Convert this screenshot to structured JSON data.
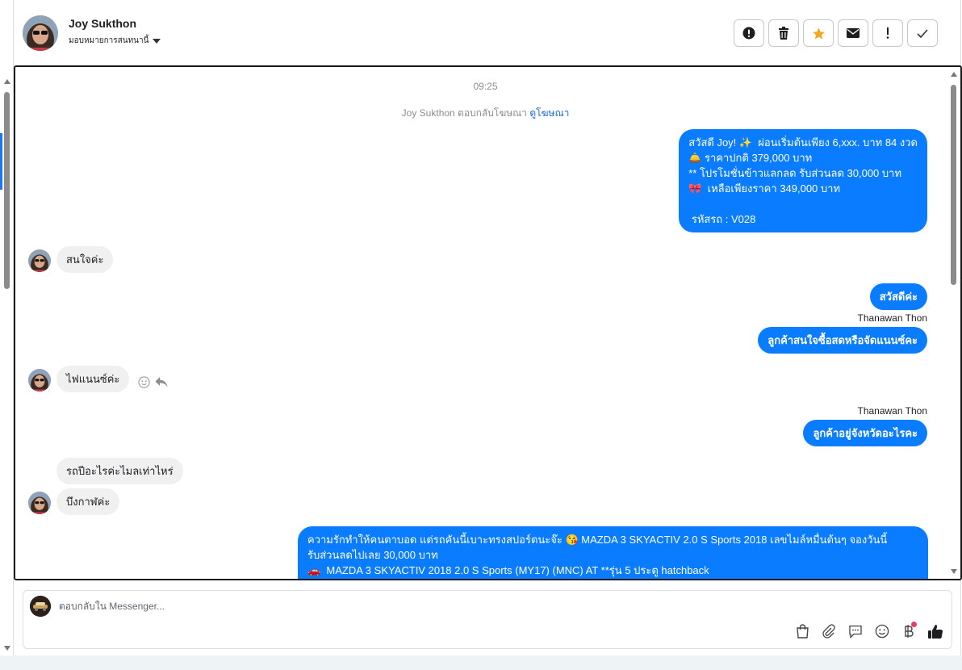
{
  "header": {
    "contact_name": "Joy Sukthon",
    "assign_label": "มอบหมายการสนทนานี้",
    "toolbar": {
      "icons": [
        "exclamation-circle-icon",
        "trash-icon",
        "star-icon",
        "envelope-icon",
        "exclamation-icon",
        "check-icon"
      ],
      "star_color": "#f5a623"
    }
  },
  "chat": {
    "timestamp": "09:25",
    "reply_note_prefix": "Joy Sukthon ตอบกลับโฆษณา",
    "reply_note_link": "ดูโฆษณา",
    "messages": [
      {
        "side": "out",
        "text": "สวัสดี Joy! ✨  ผ่อนเริ่มต้นเพียง 6,xxx. บาท 84 งวด\n🛎️ ราคาปกติ 379,000 บาท\n** โปรโมชั่นข้าวแลกลด รับส่วนลด 30,000 บาท\n🎀  เหลือเพียงราคา 349,000 บาท\n\n รหัสรถ : V028"
      },
      {
        "side": "in",
        "text": "สนใจค่ะ"
      },
      {
        "side": "out",
        "text": "สวัสดีค่ะ"
      },
      {
        "side": "out",
        "sender": "Thanawan Thon",
        "text": "ลูกค้าสนใจซื้อสดหรือจัดแนนซ์คะ"
      },
      {
        "side": "in",
        "text": "ไฟแนนซ์ค่ะ"
      },
      {
        "side": "out",
        "sender": "Thanawan Thon",
        "text": "ลูกค้าอยู่จังหวัดอะไรคะ"
      },
      {
        "side": "in",
        "text": "รถปีอะไรค่ะไมลเท่าไหร่"
      },
      {
        "side": "in",
        "text": "บึงกาฬค่ะ"
      },
      {
        "side": "out",
        "text": "ความรักทำให้คนตาบอด แต่รถคันนี้เบาะทรงสปอร์ตนะจ๊ะ 😘 MAZDA 3 SKYACTIV 2.0 S Sports 2018 เลขไมล์หมื่นต้นๆ จองวันนี้\nรับส่วนลดไปเลย 30,000 บาท\n🚗  MAZDA 3 SKYACTIV 2018 2.0 S Sports (MY17) (MNC) AT **รุ่น 5 ประตู hatchback"
      }
    ]
  },
  "composer": {
    "placeholder": "ตอบกลับใน Messenger...",
    "icons": [
      "shopping-bag-icon",
      "paperclip-icon",
      "saved-reply-icon",
      "emoji-icon",
      "baht-icon",
      "thumbs-up-icon"
    ],
    "badge_color": "#e4405f"
  },
  "colors": {
    "accent": "#0a7cff",
    "incoming_bubble": "#f0f0f0"
  }
}
